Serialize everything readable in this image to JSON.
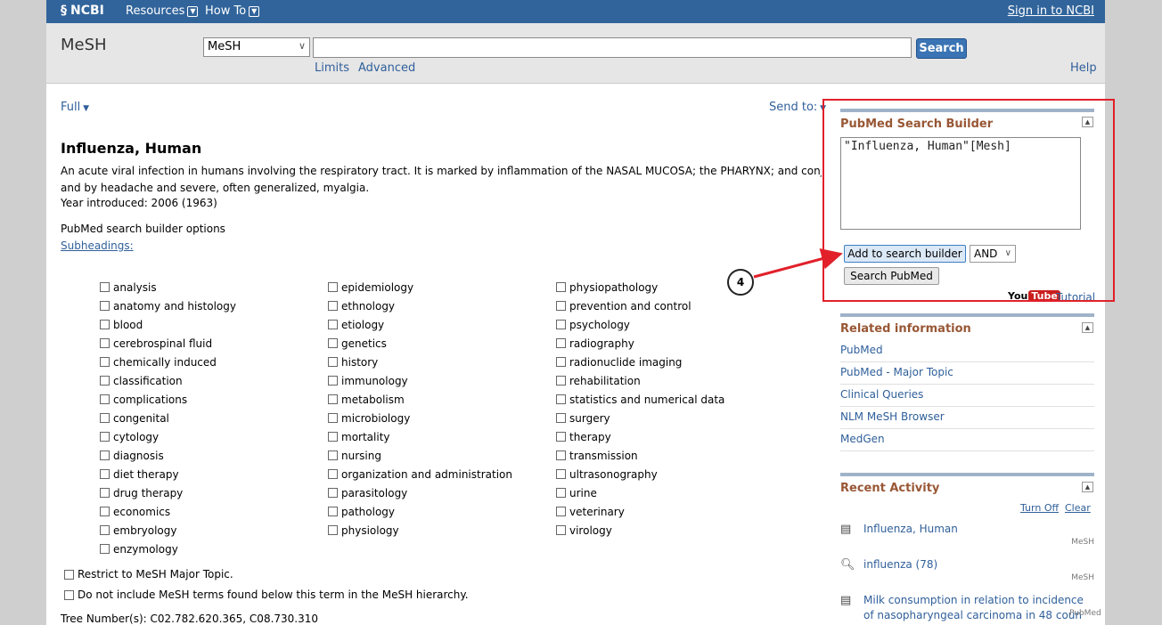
{
  "topbar": {
    "logo": "NCBI",
    "resources": "Resources",
    "howto": "How To",
    "signin": "Sign in to NCBI"
  },
  "search": {
    "db_label": "MeSH",
    "db_selected": "MeSH",
    "term": "",
    "button": "Search",
    "limits": "Limits",
    "advanced": "Advanced",
    "help": "Help"
  },
  "content": {
    "format": "Full",
    "send_to": "Send to:",
    "title": "Influenza, Human",
    "description_line1": "An acute viral infection in humans involving the respiratory tract. It is marked by inflammation of the NASAL MUCOSA; the PHARYNX; and conjunctiva,",
    "description_line2": "and by headache and severe, often generalized, myalgia.",
    "year": "Year introduced: 2006 (1963)",
    "builder_options": "PubMed search builder options",
    "subheadings": "Subheadings:",
    "col1": [
      "analysis",
      "anatomy and histology",
      "blood",
      "cerebrospinal fluid",
      "chemically induced",
      "classification",
      "complications",
      "congenital",
      "cytology",
      "diagnosis",
      "diet therapy",
      "drug therapy",
      "economics",
      "embryology",
      "enzymology"
    ],
    "col2": [
      "epidemiology",
      "ethnology",
      "etiology",
      "genetics",
      "history",
      "immunology",
      "metabolism",
      "microbiology",
      "mortality",
      "nursing",
      "organization and administration",
      "parasitology",
      "pathology",
      "physiology"
    ],
    "col3": [
      "physiopathology",
      "prevention and control",
      "psychology",
      "radiography",
      "radionuclide imaging",
      "rehabilitation",
      "statistics and numerical data",
      "surgery",
      "therapy",
      "transmission",
      "ultrasonography",
      "urine",
      "veterinary",
      "virology"
    ],
    "restrict_major": "Restrict to MeSH Major Topic.",
    "no_below": "Do not include MeSH terms found below this term in the MeSH hierarchy.",
    "tree": "Tree Number(s): C02.782.620.365, C08.730.310"
  },
  "builder": {
    "title": "PubMed Search Builder",
    "query": "\"Influenza, Human\"[Mesh]",
    "add_button": "Add to search builder",
    "operator": "AND",
    "search_button": "Search PubMed",
    "yt_you": "You",
    "yt_tube": "Tube",
    "tutorial": "Tutorial"
  },
  "related": {
    "title": "Related information",
    "items": [
      "PubMed",
      "PubMed - Major Topic",
      "Clinical Queries",
      "NLM MeSH Browser",
      "MedGen"
    ]
  },
  "recent": {
    "title": "Recent Activity",
    "turn_off": "Turn Off",
    "clear": "Clear",
    "items": [
      {
        "text": "Influenza, Human",
        "db": "MeSH",
        "icon": "document-icon"
      },
      {
        "text": "influenza (78)",
        "db": "MeSH",
        "icon": "search-icon"
      },
      {
        "text": "Milk consumption in relation to incidence of nasopharyngeal carcinoma in 48 coun",
        "db": "PubMed",
        "icon": "document-icon"
      }
    ]
  },
  "annotation": {
    "callout_number": "4",
    "color": "#e1202a"
  }
}
